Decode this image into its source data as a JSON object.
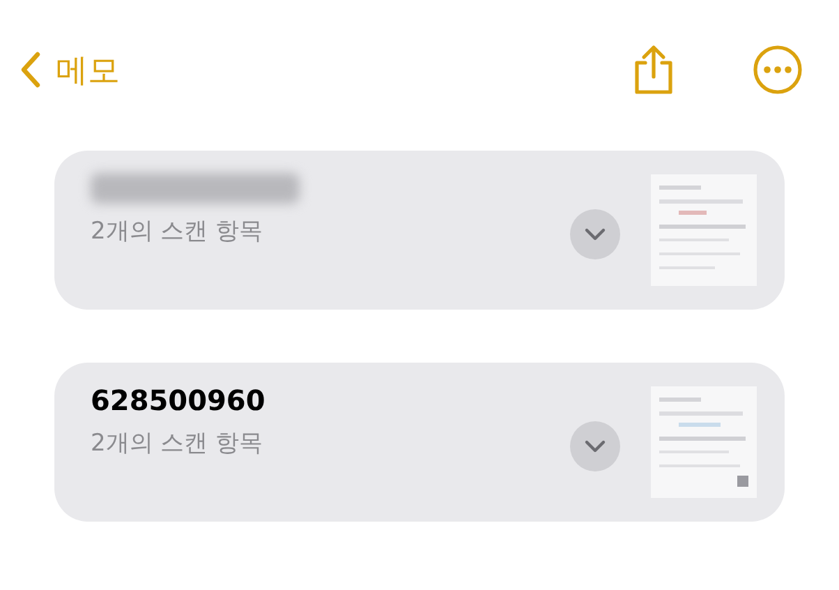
{
  "nav": {
    "back_label": "메모"
  },
  "notes": [
    {
      "redacted": true,
      "subtitle": "2개의 스캔 항목"
    },
    {
      "redacted": false,
      "title": "628500960",
      "subtitle": "2개의 스캔 항목"
    }
  ]
}
